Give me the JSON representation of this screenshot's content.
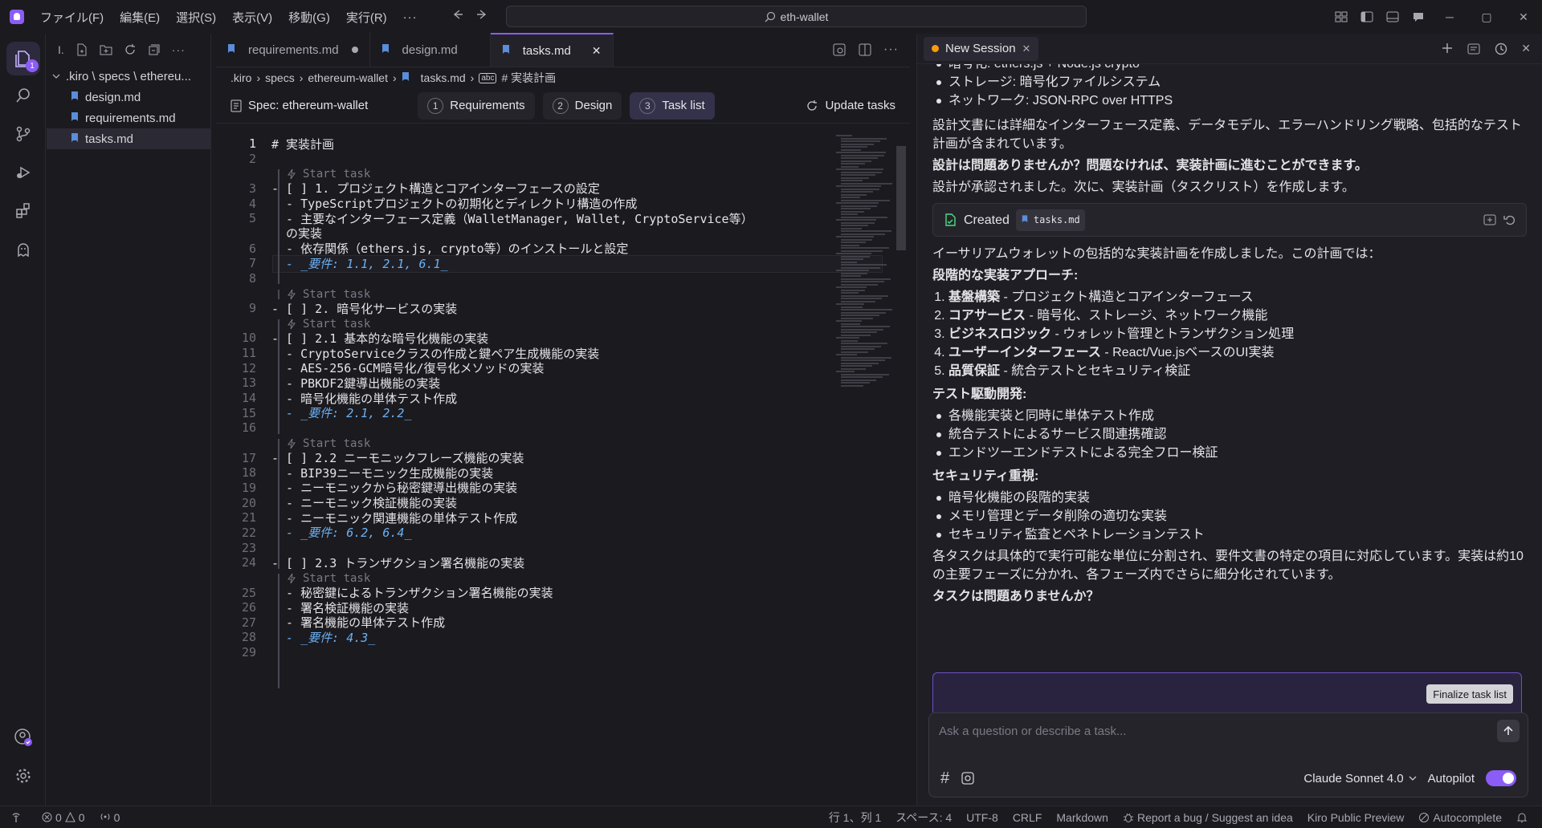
{
  "titlebar": {
    "menus": [
      "ファイル(F)",
      "編集(E)",
      "選択(S)",
      "表示(V)",
      "移動(G)",
      "実行(R)",
      "···"
    ],
    "search": "eth-wallet"
  },
  "activity": {
    "badge": "1"
  },
  "explorer": {
    "root": ".kiro \\ specs \\ ethereu...",
    "files": [
      "design.md",
      "requirements.md",
      "tasks.md"
    ]
  },
  "editor": {
    "tabs": [
      {
        "label": "requirements.md"
      },
      {
        "label": "design.md"
      },
      {
        "label": "tasks.md"
      }
    ],
    "breadcrumb": [
      ".kiro",
      "spec﻿s",
      "ethereum-wallet",
      "tasks.md",
      "# 実装計画"
    ],
    "spec": {
      "title": "Spec: ethereum-wallet",
      "steps": [
        {
          "num": "1",
          "label": "Requirements"
        },
        {
          "num": "2",
          "label": "Design"
        },
        {
          "num": "3",
          "label": "Task list"
        }
      ],
      "update": "Update tasks"
    },
    "codelens": "Start task",
    "lines": [
      {
        "n": "1",
        "t": "# 実装計画"
      },
      {
        "n": "2",
        "t": ""
      },
      {
        "n": "3",
        "t": "- [ ] 1. プロジェクト構造とコアインターフェースの設定"
      },
      {
        "n": "4",
        "t": "  - TypeScriptプロジェクトの初期化とディレクトリ構造の作成"
      },
      {
        "n": "5",
        "t": "  - 主要なインターフェース定義（WalletManager, Wallet, CryptoService等）"
      },
      {
        "n": "",
        "t": "  の実装"
      },
      {
        "n": "6",
        "t": "  - 依存関係（ethers.js, crypto等）のインストールと設定"
      },
      {
        "n": "7",
        "t": "  - _要件: 1.1, 2.1, 6.1_"
      },
      {
        "n": "8",
        "t": ""
      },
      {
        "n": "9",
        "t": "- [ ] 2. 暗号化サービスの実装"
      },
      {
        "n": "10",
        "t": "- [ ] 2.1 基本的な暗号化機能の実装"
      },
      {
        "n": "11",
        "t": "  - CryptoServiceクラスの作成と鍵ペア生成機能の実装"
      },
      {
        "n": "12",
        "t": "  - AES-256-GCM暗号化/復号化メソッドの実装"
      },
      {
        "n": "13",
        "t": "  - PBKDF2鍵導出機能の実装"
      },
      {
        "n": "14",
        "t": "  - 暗号化機能の単体テスト作成"
      },
      {
        "n": "15",
        "t": "  - _要件: 2.1, 2.2_"
      },
      {
        "n": "16",
        "t": ""
      },
      {
        "n": "17",
        "t": "- [ ] 2.2 ニーモニックフレーズ機能の実装"
      },
      {
        "n": "18",
        "t": "  - BIP39ニーモニック生成機能の実装"
      },
      {
        "n": "19",
        "t": "  - ニーモニックから秘密鍵導出機能の実装"
      },
      {
        "n": "20",
        "t": "  - ニーモニック検証機能の実装"
      },
      {
        "n": "21",
        "t": "  - ニーモニック関連機能の単体テスト作成"
      },
      {
        "n": "22",
        "t": "  - _要件: 6.2, 6.4_"
      },
      {
        "n": "23",
        "t": ""
      },
      {
        "n": "24",
        "t": "- [ ] 2.3 トランザクション署名機能の実装"
      },
      {
        "n": "25",
        "t": "  - 秘密鍵によるトランザクション署名機能の実装"
      },
      {
        "n": "26",
        "t": "  - 署名検証機能の実装"
      },
      {
        "n": "27",
        "t": "  - 署名機能の単体テスト作成"
      },
      {
        "n": "28",
        "t": "  - _要件: 4.3_"
      },
      {
        "n": "29",
        "t": ""
      }
    ]
  },
  "chat": {
    "session": "New Session",
    "top_partial": "暗号化: ethers.js + Node.js crypto",
    "bullets_top": [
      "ストレージ: 暗号化ファイルシステム",
      "ネットワーク: JSON-RPC over HTTPS"
    ],
    "p1": "設計文書には詳細なインターフェース定義、データモデル、エラーハンドリング戦略、包括的なテスト計画が含まれています。",
    "p2": "設計は問題ありませんか？問題なければ、実装計画に進むことができます。",
    "p3": "設計が承認されました。次に、実装計画（タスクリスト）を作成します。",
    "created_label": "Created",
    "created_file": "tasks.md",
    "p4": "イーサリアムウォレットの包括的な実装計画を作成しました。この計画では：",
    "h1": "段階的な実装アプローチ:",
    "steps": [
      {
        "b": "基盤構築",
        "t": " - プロジェクト構造とコアインターフェース"
      },
      {
        "b": "コアサービス",
        "t": " - 暗号化、ストレージ、ネットワーク機能"
      },
      {
        "b": "ビジネスロジック",
        "t": " - ウォレット管理とトランザクション処理"
      },
      {
        "b": "ユーザーインターフェース",
        "t": " - React/Vue.jsベースのUI実装"
      },
      {
        "b": "品質保証",
        "t": " - 統合テストとセキュリティ検証"
      }
    ],
    "h2": "テスト駆動開発:",
    "tdd": [
      "各機能実装と同時に単体テスト作成",
      "統合テストによるサービス間連携確認",
      "エンドツーエンドテストによる完全フロー検証"
    ],
    "h3": "セキュリティ重視:",
    "sec": [
      "暗号化機能の段階的実装",
      "メモリ管理とデータ削除の適切な実装",
      "セキュリティ監査とペネトレーションテスト"
    ],
    "p5": "各タスクは具体的で実行可能な単位に分割され、要件文書の特定の項目に対応しています。実装は約10の主要フェーズに分かれ、各フェーズ内でさらに細分化されています。",
    "p6": "タスクは問題ありませんか？",
    "finalize": "Finalize task list",
    "placeholder": "Ask a question or describe a task...",
    "model": "Claude Sonnet 4.0",
    "autopilot": "Autopilot"
  },
  "status": {
    "errors": "0",
    "warnings": "0",
    "ports": "0",
    "position": "行 1、列 1",
    "spaces": "スペース: 4",
    "encoding": "UTF-8",
    "eol": "CRLF",
    "lang": "Markdown",
    "report": "Report a bug / Suggest an idea",
    "preview": "Kiro Public Preview",
    "autocomplete": "Autocomplete"
  }
}
